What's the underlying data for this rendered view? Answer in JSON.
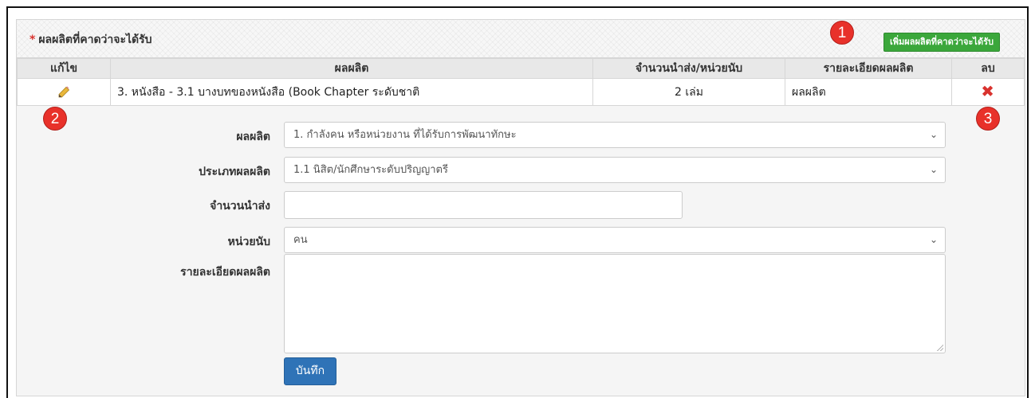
{
  "panel": {
    "required_mark": "*",
    "title": "ผลผลิตที่คาดว่าจะได้รับ",
    "add_button": "เพิ่มผลผลิตที่คาดว่าจะได้รับ"
  },
  "markers": [
    "1",
    "2",
    "3"
  ],
  "table": {
    "headers": [
      "แก้ไข",
      "ผลผลิต",
      "จำนวนนำส่ง/หน่วยนับ",
      "รายละเอียดผลผลิต",
      "ลบ"
    ],
    "rows": [
      {
        "product": "3. หนังสือ - 3.1 บางบทของหนังสือ (Book Chapter ระดับชาติ",
        "amount": "2 เล่ม",
        "detail": "ผลผลิต",
        "edit_icon": "pencil-icon",
        "delete_icon": "close-icon"
      }
    ]
  },
  "form": {
    "product_label": "ผลผลิต",
    "product_value": "1. กำลังคน หรือหน่วยงาน ที่ได้รับการพัฒนาทักษะ",
    "type_label": "ประเภทผลผลิต",
    "type_value": "1.1 นิสิต/นักศึกษาระดับปริญญาตรี",
    "amount_label": "จำนวนนำส่ง",
    "amount_value": "",
    "unit_label": "หน่วยนับ",
    "unit_value": "คน",
    "detail_label": "รายละเอียดผลผลิต",
    "detail_value": "",
    "save_button": "บันทึก"
  },
  "colors": {
    "add_button": "#3ba73b",
    "save_button": "#2f73b7",
    "marker": "#e8312a",
    "delete": "#d9322e"
  }
}
